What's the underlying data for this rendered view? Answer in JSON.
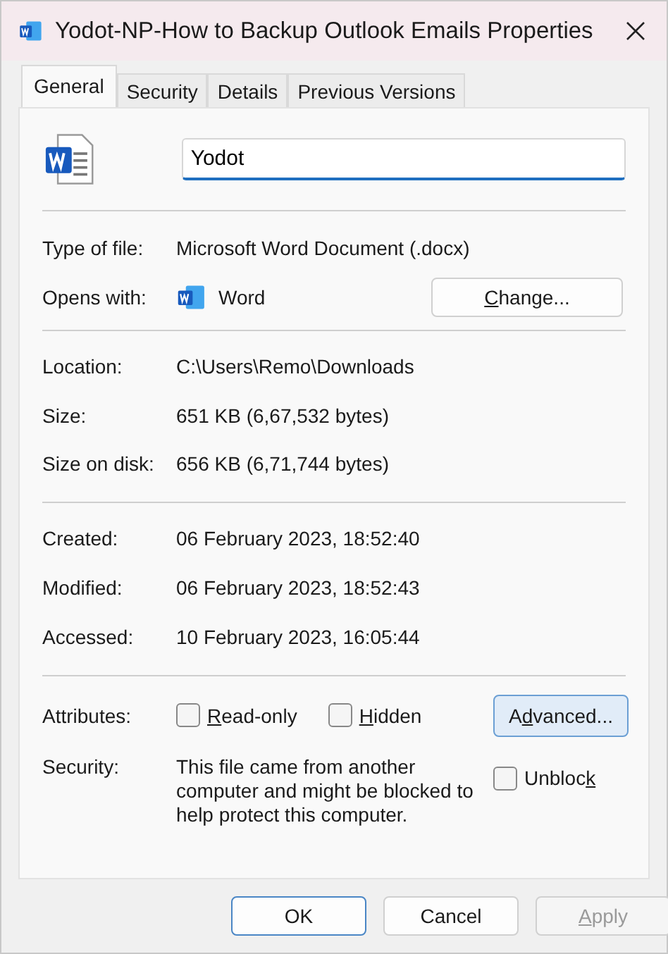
{
  "window": {
    "title": "Yodot-NP-How to Backup Outlook Emails Properties"
  },
  "tabs": [
    {
      "label": "General",
      "selected": true
    },
    {
      "label": "Security",
      "selected": false
    },
    {
      "label": "Details",
      "selected": false
    },
    {
      "label": "Previous Versions",
      "selected": false
    }
  ],
  "file_name": "Yodot",
  "type_row": {
    "label": "Type of file:",
    "value": "Microsoft Word Document (.docx)"
  },
  "opens_with": {
    "label": "Opens with:",
    "app": "Word",
    "button": {
      "key": "C",
      "after": "hange..."
    }
  },
  "location_rows": [
    {
      "label": "Location:",
      "value": "C:\\Users\\Remo\\Downloads"
    },
    {
      "label": "Size:",
      "value": "651 KB (6,67,532 bytes)"
    },
    {
      "label": "Size on disk:",
      "value": "656 KB (6,71,744 bytes)"
    }
  ],
  "date_rows": [
    {
      "label": "Created:",
      "value": "06 February 2023, 18:52:40"
    },
    {
      "label": "Modified:",
      "value": "06 February 2023, 18:52:43"
    },
    {
      "label": "Accessed:",
      "value": "10 February 2023, 16:05:44"
    }
  ],
  "attributes": {
    "label": "Attributes:",
    "checkboxes": [
      {
        "label": {
          "key": "R",
          "after": "ead-only"
        },
        "checked": false
      },
      {
        "label": {
          "key": "H",
          "after": "idden"
        },
        "checked": false
      }
    ],
    "button": {
      "label": {
        "before": "A",
        "key": "d",
        "after": "vanced..."
      },
      "focused": true
    }
  },
  "security": {
    "label": "Security:",
    "text": "This file came from another computer and might be blocked to help protect this computer.",
    "checkbox": {
      "label": {
        "before": "Unbloc",
        "key": "k"
      },
      "checked": false
    }
  },
  "buttons": [
    {
      "label": {
        "before": "OK"
      },
      "default": true,
      "disabled": false
    },
    {
      "label": {
        "before": "Cancel"
      },
      "default": false,
      "disabled": false
    },
    {
      "label": {
        "key": "A",
        "after": "pply"
      },
      "default": false,
      "disabled": true
    }
  ]
}
